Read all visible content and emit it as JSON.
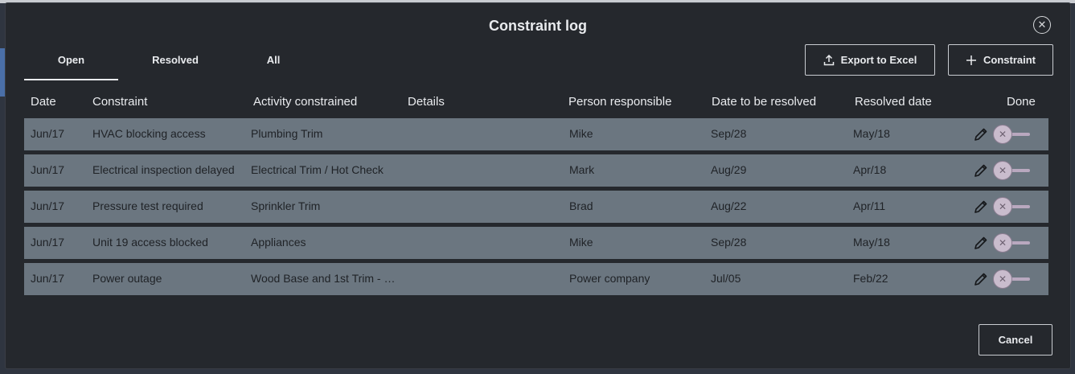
{
  "dialog": {
    "title": "Constraint log",
    "close_icon": "close-icon"
  },
  "tabs": [
    {
      "label": "Open",
      "active": true
    },
    {
      "label": "Resolved",
      "active": false
    },
    {
      "label": "All",
      "active": false
    }
  ],
  "toolbar": {
    "export_label": "Export to Excel",
    "export_icon": "upload-icon",
    "add_label": "Constraint",
    "add_icon": "plus-icon"
  },
  "columns": [
    "Date",
    "Constraint",
    "Activity constrained",
    "Details",
    "Person responsible",
    "Date to be resolved",
    "Resolved date",
    "Done"
  ],
  "rows": [
    {
      "date": "Jun/17",
      "constraint": "HVAC blocking access",
      "activity": "Plumbing Trim",
      "details": "",
      "person": "Mike",
      "due": "Sep/28",
      "resolved": "May/18",
      "done": false
    },
    {
      "date": "Jun/17",
      "constraint": "Electrical inspection delayed",
      "activity": "Electrical Trim / Hot Check",
      "details": "",
      "person": "Mark",
      "due": "Aug/29",
      "resolved": "Apr/18",
      "done": false
    },
    {
      "date": "Jun/17",
      "constraint": "Pressure test required",
      "activity": "Sprinkler Trim",
      "details": "",
      "person": "Brad",
      "due": "Aug/22",
      "resolved": "Apr/11",
      "done": false
    },
    {
      "date": "Jun/17",
      "constraint": "Unit 19 access blocked",
      "activity": "Appliances",
      "details": "",
      "person": "Mike",
      "due": "Sep/28",
      "resolved": "May/18",
      "done": false
    },
    {
      "date": "Jun/17",
      "constraint": "Power outage",
      "activity": "Wood Base and 1st Trim - …",
      "details": "",
      "person": "Power company",
      "due": "Jul/05",
      "resolved": "Feb/22",
      "done": false
    }
  ],
  "footer": {
    "cancel_label": "Cancel"
  },
  "colors": {
    "dialog_bg": "#25282d",
    "row_bg": "#6b7680",
    "text": "#e9ebee"
  }
}
